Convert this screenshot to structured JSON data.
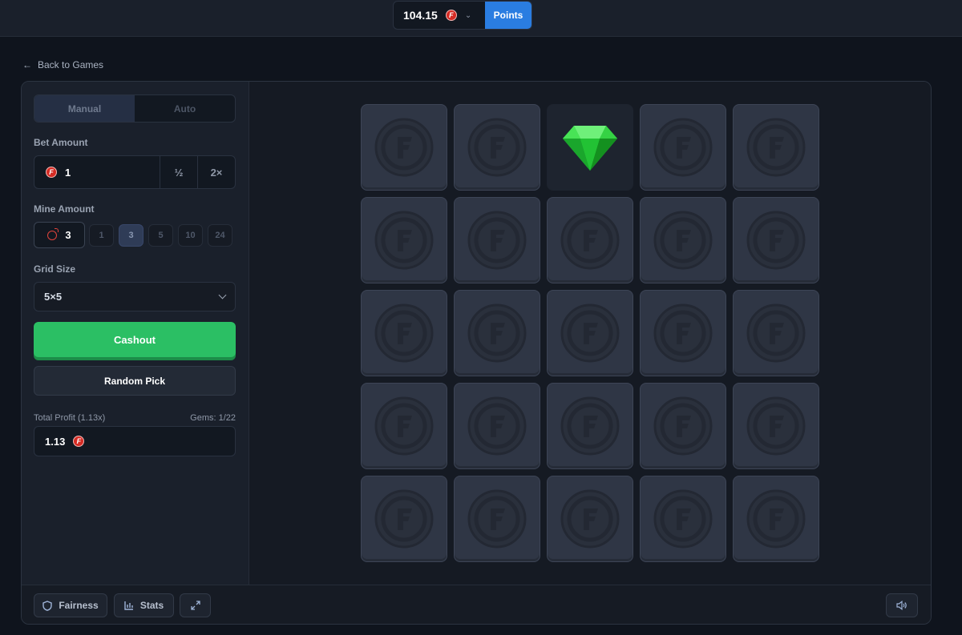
{
  "header": {
    "balance": "104.15",
    "currency_icon": "f-coin-icon",
    "points_label": "Points"
  },
  "nav": {
    "back_label": "Back to Games"
  },
  "sidebar": {
    "modes": [
      {
        "label": "Manual",
        "active": true
      },
      {
        "label": "Auto",
        "active": false
      }
    ],
    "bet_amount_label": "Bet Amount",
    "bet_value": "1",
    "half_label": "½",
    "double_label": "2×",
    "mine_amount_label": "Mine Amount",
    "mine_current": "3",
    "mine_options": [
      "1",
      "3",
      "5",
      "10",
      "24"
    ],
    "mine_selected": "3",
    "grid_size_label": "Grid Size",
    "grid_size_value": "5×5",
    "cashout_label": "Cashout",
    "random_pick_label": "Random Pick",
    "total_profit_label": "Total Profit (1.13x)",
    "gems_label": "Gems: 1/22",
    "profit_value": "1.13"
  },
  "board": {
    "rows": 5,
    "cols": 5,
    "revealed": [
      {
        "row": 1,
        "col": 3,
        "type": "gem"
      }
    ]
  },
  "footer": {
    "fairness_label": "Fairness",
    "stats_label": "Stats"
  },
  "colors": {
    "accent_blue": "#2a7de1",
    "cashout_green": "#2bbf64",
    "coin_red": "#d52b24",
    "gem_green": "#27d83c"
  }
}
